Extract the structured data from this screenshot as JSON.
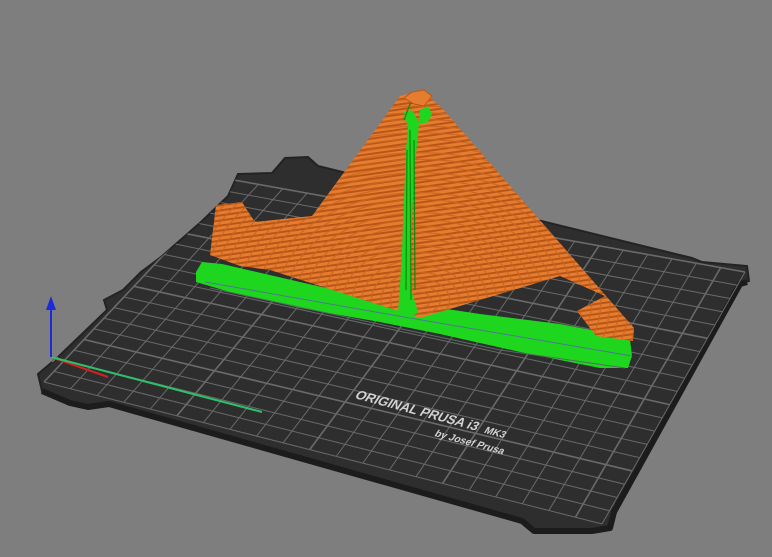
{
  "viewport": {
    "background_color": "#7e7e7e"
  },
  "bed": {
    "logo_line1": "ORIGINAL PRUSA i3",
    "logo_model": "MK3",
    "logo_line2": "by Josef Prusa",
    "surface_color": "#2e2e2e",
    "grid_color": "#6a6a6a"
  },
  "axes": {
    "x_color": "#d42020",
    "y_color": "#2fbf6a",
    "z_color": "#1a2bd8"
  },
  "model": {
    "perimeter_color": "#e0782c",
    "support_color": "#1fd61f"
  }
}
